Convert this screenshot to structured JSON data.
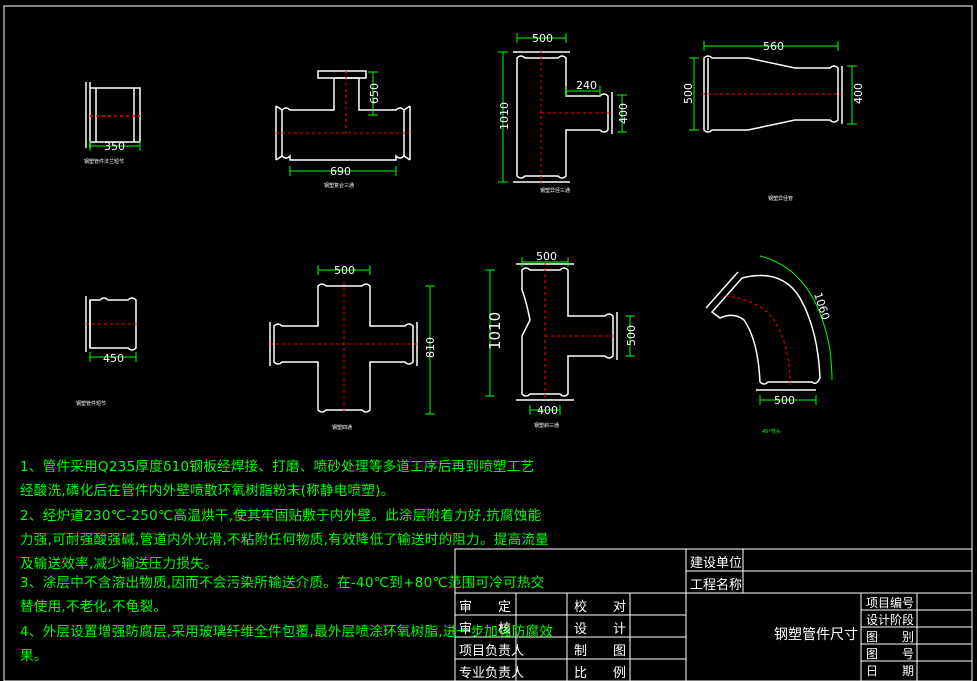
{
  "colors": {
    "background": "#000000",
    "outline": "#ffffff",
    "centerline": "#ff0000",
    "dimension": "#00ff00",
    "border": "#ffffff"
  },
  "parts": {
    "p1": {
      "dim_w": "350",
      "label": "钢塑管件法兰短节"
    },
    "p2": {
      "dim_w": "690",
      "dim_h": "650",
      "label": "钢塑复合三通"
    },
    "p3": {
      "dim_top": "500",
      "dim_h": "1010",
      "dim_branch": "240",
      "dim_side": "400",
      "label": "钢塑异径三通"
    },
    "p4": {
      "dim_w": "560",
      "dim_left": "500",
      "dim_right": "400",
      "label": "钢塑异径管"
    },
    "p5": {
      "dim_w": "450",
      "label": "钢塑管件短节"
    },
    "p6": {
      "dim_top": "500",
      "dim_h": "810",
      "label": "钢塑四通"
    },
    "p7": {
      "dim_top": "500",
      "dim_h": "1010",
      "dim_side": "500",
      "dim_bottom": "400",
      "label": "钢塑斜三通"
    },
    "p8": {
      "dim_arc": "1060",
      "dim_bottom": "500",
      "label": "45°弯头"
    }
  },
  "notes": [
    "1、管件采用Q235厚度δ10钢板经焊接、打磨、喷砂处理等多道工序后再到喷塑工艺",
    "经酸洗,磷化后在管件内外壁喷散环氧树脂粉末(称静电喷塑)。",
    "2、经炉道230℃-250℃高温烘干,使其牢固贴敷于内外壁。此涂层附着力好,抗腐蚀能",
    "力强,可耐强酸强碱,管道内外光滑,不粘附任何物质,有效降低了输送时的阻力。提高流量",
    "及输送效率,减少输送压力损失。",
    "3、涂层中不含溶出物质,因而不会污染所输送介质。在-40℃到+80℃范围可冷可热交",
    "替使用,不老化,不龟裂。",
    "4、外层设置增强防腐层,采用玻璃纤维全件包覆,最外层喷涂环氧树脂,进一步加强防腐效",
    "果。"
  ],
  "title_block": {
    "construction_unit_label": "建设单位",
    "project_name_label": "工程名称",
    "rows_left": [
      {
        "label": "审　　定",
        "right": "校　　对"
      },
      {
        "label": "审　　核",
        "right": "设　　计"
      },
      {
        "label": "项目负责人",
        "right": "制　　图"
      },
      {
        "label": "专业负责人",
        "right": "比　　例"
      }
    ],
    "drawing_title": "钢塑管件尺寸",
    "rows_right": [
      "项目编号",
      "设计阶段",
      "图　　别",
      "图　　号",
      "日　　期"
    ]
  }
}
